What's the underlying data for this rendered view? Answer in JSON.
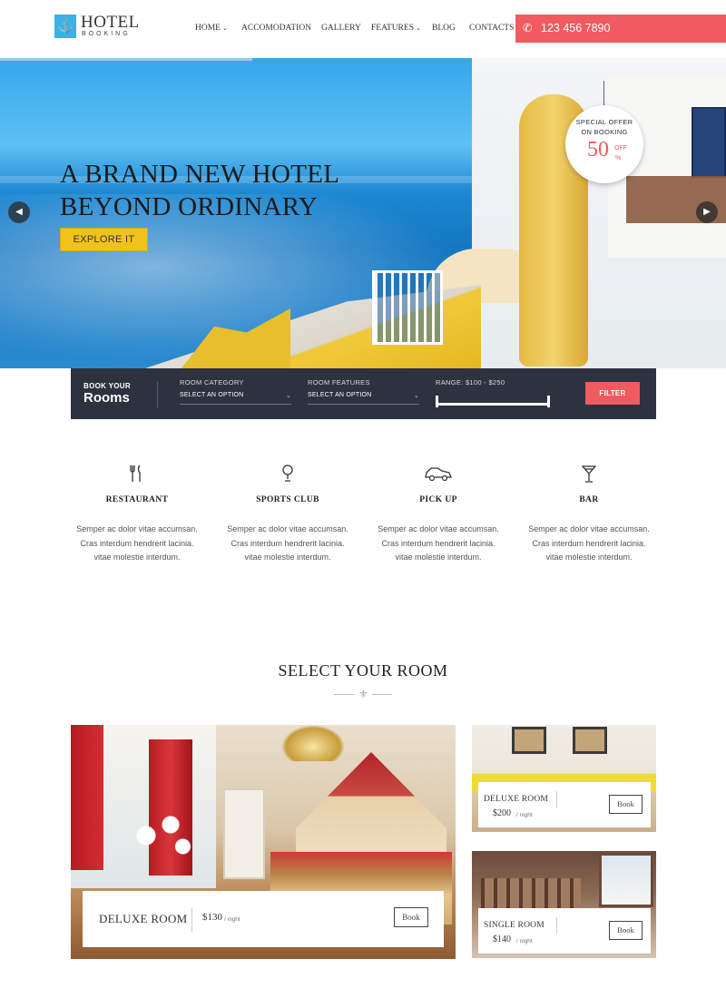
{
  "header": {
    "logo_title": "HOTEL",
    "logo_subtitle": "BOOKING",
    "logo_icon": "anchor-icon",
    "nav": [
      {
        "label": "HOME",
        "dropdown": true
      },
      {
        "label": "ACCOMODATION",
        "dropdown": false
      },
      {
        "label": "GALLERY",
        "dropdown": false
      },
      {
        "label": "FEATURES",
        "dropdown": true
      },
      {
        "label": "BLOG",
        "dropdown": false
      },
      {
        "label": "CONTACTS",
        "dropdown": false
      }
    ],
    "phone": "123 456 7890",
    "phone_icon": "phone-icon"
  },
  "hero": {
    "title_line1": "A BRAND NEW HOTEL",
    "title_line2": "BEYOND ORDINARY",
    "button": "EXPLORE IT",
    "offer": {
      "line1": "SPECIAL OFFER",
      "line2": "ON BOOKING",
      "percent": "50",
      "off": "OFF",
      "percent_sign": "%"
    }
  },
  "booking": {
    "title_small": "BOOK YOUR",
    "title_large": "Rooms",
    "category_label": "ROOM CATEGORY",
    "category_value": "SELECT AN OPTION",
    "features_label": "ROOM FEATURES",
    "features_value": "SELECT AN OPTION",
    "range_label": "RANGE:",
    "range_min": "$100",
    "range_max": "$250",
    "filter_button": "FILTER"
  },
  "features": [
    {
      "icon": "fork-knife-icon",
      "title": "RESTAURANT",
      "line1": "Semper ac dolor vitae accumsan.",
      "line2": "Cras interdum hendrerit lacinia.",
      "line3": "vitae molestie interdum."
    },
    {
      "icon": "golf-icon",
      "title": "SPORTS CLUB",
      "line1": "Semper ac dolor vitae accumsan.",
      "line2": "Cras interdum hendrerit lacinia.",
      "line3": "vitae molestie interdum."
    },
    {
      "icon": "car-icon",
      "title": "PICK UP",
      "line1": "Semper ac dolor vitae accumsan.",
      "line2": "Cras interdum hendrerit lacinia.",
      "line3": "vitae molestie interdum."
    },
    {
      "icon": "cocktail-icon",
      "title": "BAR",
      "line1": "Semper ac dolor vitae accumsan.",
      "line2": "Cras interdum hendrerit lacinia.",
      "line3": "vitae molestie interdum."
    }
  ],
  "rooms_section": {
    "title": "SELECT YOUR ROOM",
    "rooms": [
      {
        "name": "DELUXE ROOM",
        "price": "$130",
        "per": "/ night",
        "book": "Book"
      },
      {
        "name": "DELUXE ROOM",
        "price": "$200",
        "per": "/ night",
        "book": "Book"
      },
      {
        "name": "SINGLE ROOM",
        "price": "$140",
        "per": "/ night",
        "book": "Book"
      }
    ]
  },
  "colors": {
    "accent_red": "#f15a5e",
    "accent_yellow": "#f2c21c",
    "logo_blue": "#3cb1e6",
    "booking_bg": "#2d323e"
  }
}
